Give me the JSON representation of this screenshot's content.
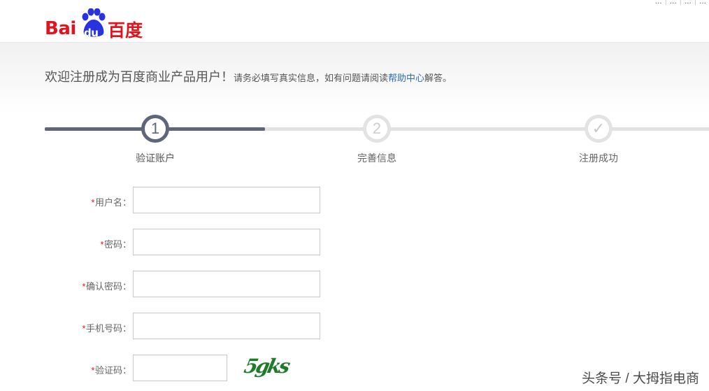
{
  "header": {
    "top_links": [
      "...",
      "...",
      "...",
      "..."
    ],
    "logo": {
      "bai": "Bai",
      "du": "du",
      "cn": "百度"
    }
  },
  "welcome": {
    "title": "欢迎注册成为百度商业产品用户！",
    "note_prefix": "请务必填写真实信息，如有问题请阅读",
    "help_link": "帮助中心",
    "note_suffix": "解答。"
  },
  "steps": [
    {
      "number": "1",
      "label": "验证账户",
      "state": "active"
    },
    {
      "number": "2",
      "label": "完善信息",
      "state": "inactive"
    },
    {
      "number": "✓",
      "label": "注册成功",
      "state": "inactive"
    }
  ],
  "progress_fraction": 0.33,
  "form": {
    "required_mark": "*",
    "fields": [
      {
        "label": "用户名：",
        "value": ""
      },
      {
        "label": "密码：",
        "value": ""
      },
      {
        "label": "确认密码：",
        "value": ""
      },
      {
        "label": "手机号码：",
        "value": ""
      },
      {
        "label": "验证码：",
        "value": ""
      }
    ],
    "captcha_text": "5gks"
  },
  "watermark": "头条号 / 大拇指电商",
  "colors": {
    "brand_red": "#e0141e",
    "step_active": "#5f6679",
    "link_blue": "#2b6cb8",
    "captcha_green": "#1f7a2a"
  }
}
